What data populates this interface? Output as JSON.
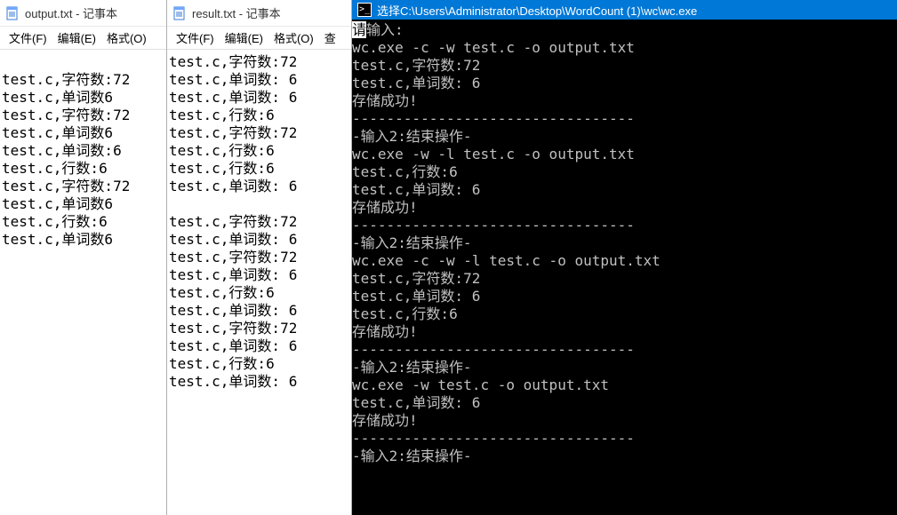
{
  "win1": {
    "title": "output.txt - 记事本",
    "menu": [
      "文件(F)",
      "编辑(E)",
      "格式(O)"
    ],
    "lines": [
      "",
      "test.c,字符数:72",
      "test.c,单词数6",
      "test.c,字符数:72",
      "test.c,单词数6",
      "test.c,单词数:6",
      "test.c,行数:6",
      "test.c,字符数:72",
      "test.c,单词数6",
      "test.c,行数:6",
      "test.c,单词数6"
    ]
  },
  "win2": {
    "title": "result.txt - 记事本",
    "menu": [
      "文件(F)",
      "编辑(E)",
      "格式(O)",
      "查"
    ],
    "lines": [
      "test.c,字符数:72",
      "test.c,单词数: 6",
      "test.c,单词数: 6",
      "test.c,行数:6",
      "test.c,字符数:72",
      "test.c,行数:6",
      "test.c,行数:6",
      "test.c,单词数: 6",
      "",
      "test.c,字符数:72",
      "test.c,单词数: 6",
      "test.c,字符数:72",
      "test.c,单词数: 6",
      "test.c,行数:6",
      "test.c,单词数: 6",
      "test.c,字符数:72",
      "test.c,单词数: 6",
      "test.c,行数:6",
      "test.c,单词数: 6"
    ]
  },
  "console": {
    "title": "选择C:\\Users\\Administrator\\Desktop\\WordCount (1)\\wc\\wc.exe",
    "highlight_first": "请",
    "highlight_rest": "输入:",
    "lines": [
      "wc.exe -c -w test.c -o output.txt",
      "test.c,字符数:72",
      "test.c,单词数: 6",
      "存储成功!",
      "---------------------------------",
      "-输入2:结束操作-",
      "wc.exe -w -l test.c -o output.txt",
      "test.c,行数:6",
      "test.c,单词数: 6",
      "存储成功!",
      "---------------------------------",
      "-输入2:结束操作-",
      "wc.exe -c -w -l test.c -o output.txt",
      "test.c,字符数:72",
      "test.c,单词数: 6",
      "test.c,行数:6",
      "存储成功!",
      "---------------------------------",
      "-输入2:结束操作-",
      "wc.exe -w test.c -o output.txt",
      "test.c,单词数: 6",
      "存储成功!",
      "---------------------------------",
      "-输入2:结束操作-",
      ""
    ]
  }
}
